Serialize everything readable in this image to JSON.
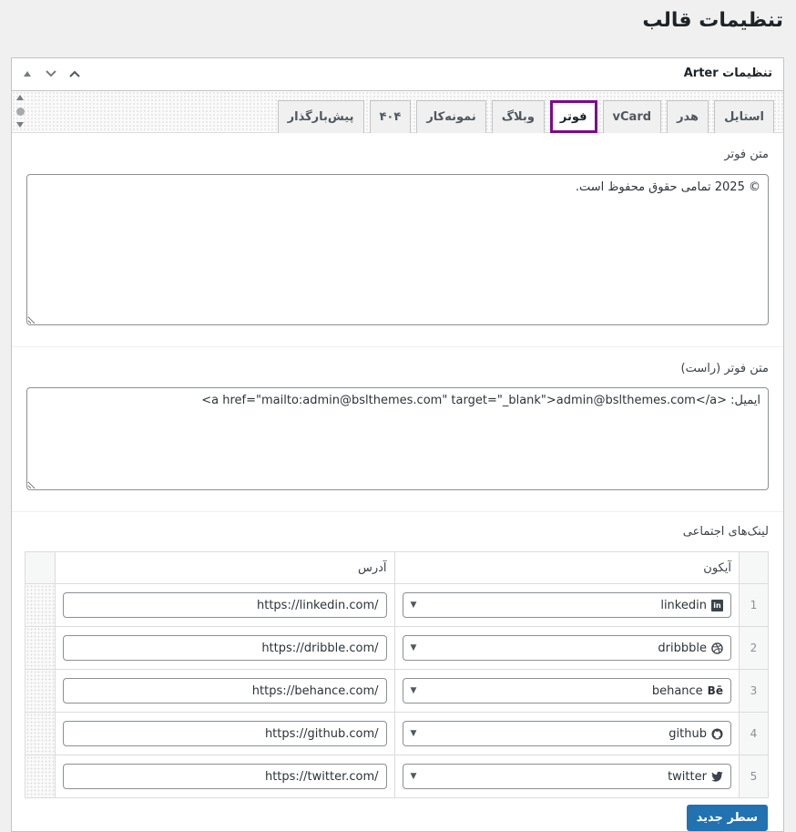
{
  "page": {
    "title": "تنظیمات قالب"
  },
  "postbox": {
    "title": "تنظیمات Arter",
    "actions": {
      "up": "▲",
      "down": "⌄",
      "toggle": "⌃"
    }
  },
  "tabs": [
    {
      "label": "استایل"
    },
    {
      "label": "هدر"
    },
    {
      "label": "vCard"
    },
    {
      "label": "فوتر",
      "active": true
    },
    {
      "label": "وبلاگ"
    },
    {
      "label": "نمونه‌کار"
    },
    {
      "label": "۴۰۴"
    },
    {
      "label": "پیش‌بارگذار"
    }
  ],
  "footer_text": {
    "label": "متن فوتر",
    "value": "© 2025 تمامی حقوق محفوظ است."
  },
  "footer_text_right": {
    "label": "متن فوتر (راست)",
    "value": "ایمیل: <a href=\"mailto:admin@bslthemes.com\" target=\"_blank\">admin@bslthemes.com</a>"
  },
  "social": {
    "label": "لینک‌های اجتماعی",
    "col_icon": "آیکون",
    "col_url": "آدرس",
    "rows": [
      {
        "num": "1",
        "icon": "linkedin",
        "icon_name": "linkedin-icon",
        "url": "https://linkedin.com/"
      },
      {
        "num": "2",
        "icon": "dribbble",
        "icon_name": "dribbble-icon",
        "url": "https://dribble.com/"
      },
      {
        "num": "3",
        "icon": "behance",
        "icon_name": "behance-icon",
        "url": "https://behance.com/"
      },
      {
        "num": "4",
        "icon": "github",
        "icon_name": "github-icon",
        "url": "https://github.com/"
      },
      {
        "num": "5",
        "icon": "twitter",
        "icon_name": "twitter-icon",
        "url": "https://twitter.com/"
      }
    ],
    "add_row": "سطر جدید"
  },
  "colors": {
    "accent": "#2271b1",
    "active_tab_outline": "#7b0a8c"
  }
}
